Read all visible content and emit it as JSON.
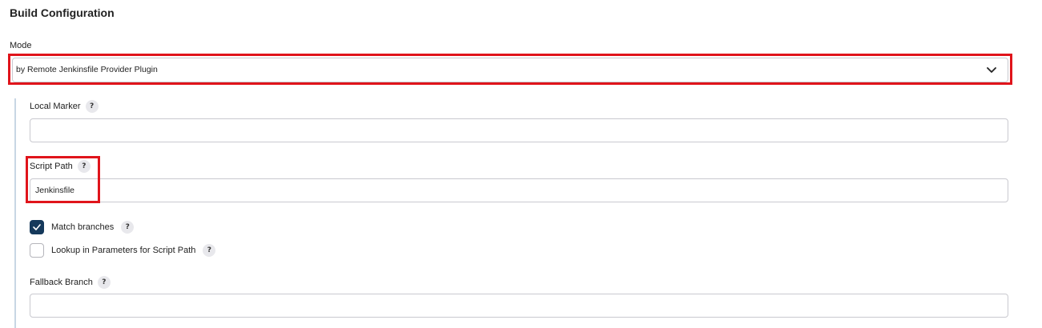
{
  "section": {
    "title": "Build Configuration"
  },
  "mode": {
    "label": "Mode",
    "selected": "by Remote Jenkinsfile Provider Plugin"
  },
  "fields": {
    "local_marker": {
      "label": "Local Marker",
      "value": ""
    },
    "script_path": {
      "label": "Script Path",
      "value": "Jenkinsfile"
    },
    "fallback_branch": {
      "label": "Fallback Branch",
      "value": ""
    }
  },
  "checkboxes": {
    "match_branches": {
      "label": "Match branches",
      "checked": true
    },
    "lookup_params": {
      "label": "Lookup in Parameters for Script Path",
      "checked": false
    }
  },
  "help_icon_text": "?",
  "colors": {
    "highlight": "#e0141b",
    "checkbox_checked": "#15395b",
    "nest_bar": "#c8d6e4"
  },
  "icons": {
    "dropdown": "chevron-down-icon",
    "help": "help-icon",
    "check": "check-icon"
  }
}
